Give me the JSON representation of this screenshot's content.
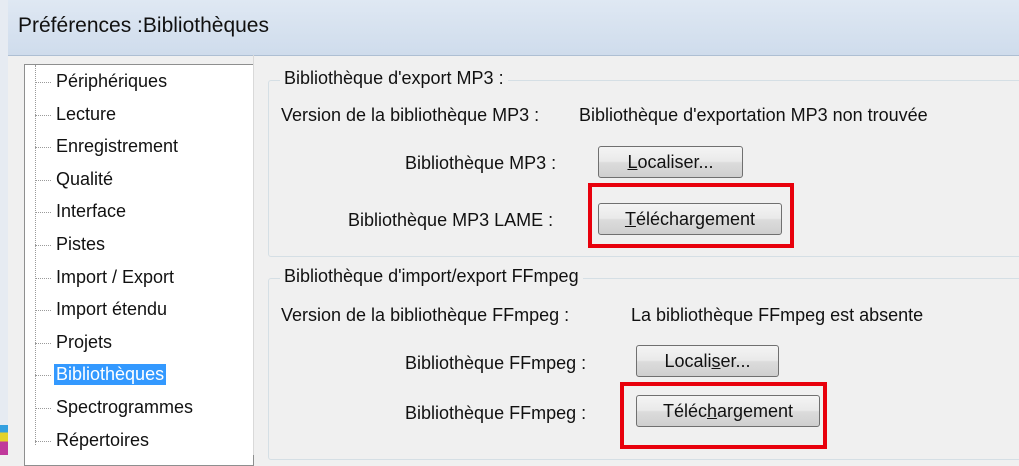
{
  "window": {
    "title": "Préférences :Bibliothèques"
  },
  "tree": {
    "items": [
      {
        "label": "Périphériques",
        "selected": false
      },
      {
        "label": "Lecture",
        "selected": false
      },
      {
        "label": "Enregistrement",
        "selected": false
      },
      {
        "label": "Qualité",
        "selected": false
      },
      {
        "label": "Interface",
        "selected": false
      },
      {
        "label": "Pistes",
        "selected": false
      },
      {
        "label": "Import / Export",
        "selected": false
      },
      {
        "label": "Import étendu",
        "selected": false
      },
      {
        "label": "Projets",
        "selected": false
      },
      {
        "label": "Bibliothèques",
        "selected": true
      },
      {
        "label": "Spectrogrammes",
        "selected": false
      },
      {
        "label": "Répertoires",
        "selected": false
      }
    ]
  },
  "mp3": {
    "group_title": "Bibliothèque d'export MP3 :",
    "version_label": "Version de la bibliothèque MP3 :",
    "version_value": "Bibliothèque d'exportation MP3 non trouvée",
    "library_label": "Bibliothèque MP3 :",
    "locate_button": {
      "before": "",
      "underlined": "L",
      "after": "ocaliser..."
    },
    "lame_label": "Bibliothèque MP3 LAME :",
    "download_button": {
      "before": "",
      "underlined": "T",
      "after": "éléchargement"
    }
  },
  "ffmpeg": {
    "group_title": "Bibliothèque d'import/export FFmpeg",
    "version_label": "Version de la bibliothèque FFmpeg :",
    "version_value": "La bibliothèque FFmpeg est absente",
    "library_label": "Bibliothèque FFmpeg :",
    "locate_button": {
      "before": "Locali",
      "underlined": "s",
      "after": "er..."
    },
    "download_label": "Bibliothèque FFmpeg :",
    "download_button": {
      "before": "Téléc",
      "underlined": "h",
      "after": "argement"
    }
  },
  "highlight_color": "#e8000c"
}
